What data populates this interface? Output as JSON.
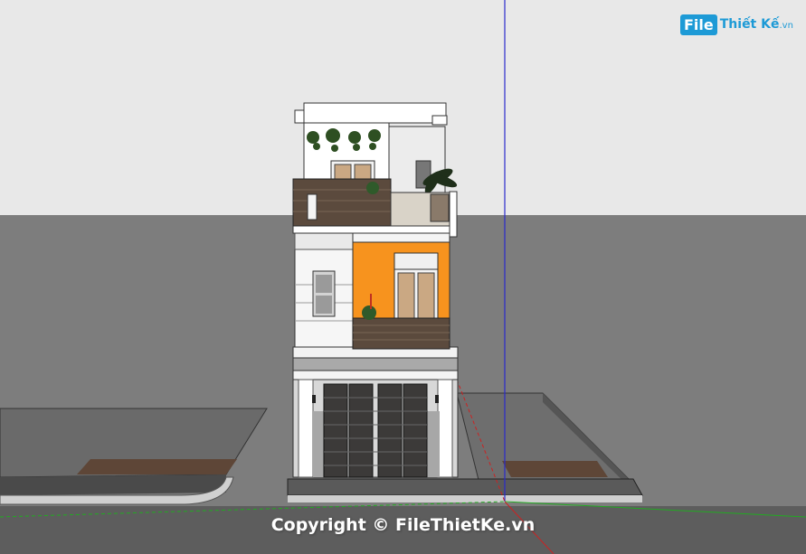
{
  "watermark": {
    "brand_file": "File",
    "brand_name": "Thiết Kế",
    "brand_domain": ".vn",
    "copyright": "Copyright © FileThietKe.vn"
  },
  "colors": {
    "sky": "#e6e6e6",
    "ground": "#7a7a7a",
    "road": "#5a5a5a",
    "facade_orange": "#f7931e",
    "wood": "#5b4a3d",
    "axis_blue": "#2a2acc",
    "axis_red": "#cc2222",
    "axis_green": "#22aa22"
  }
}
